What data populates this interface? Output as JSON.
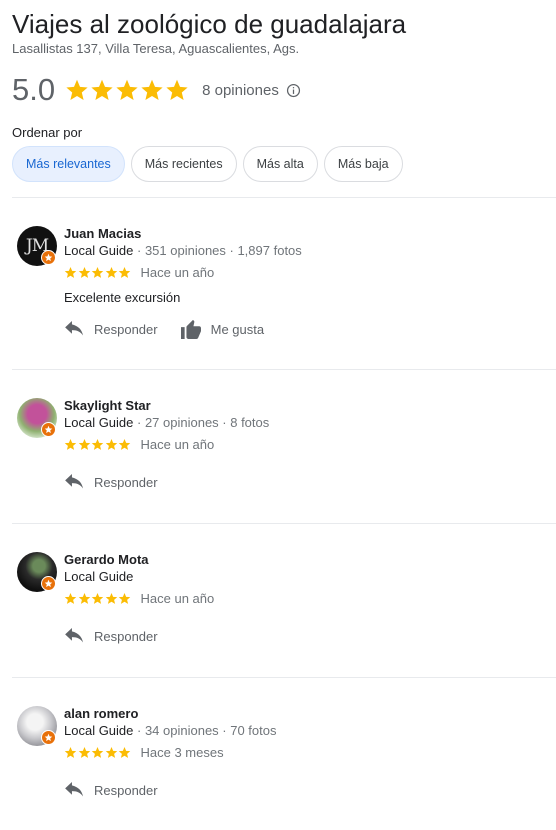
{
  "header": {
    "title": "Viajes al zoológico de guadalajara",
    "address": "Lasallistas 137, Villa Teresa, Aguascalientes, Ags.",
    "rating": "5.0",
    "rating_value": 5,
    "review_count": "8 opiniones"
  },
  "sort": {
    "label": "Ordenar por",
    "options": [
      "Más relevantes",
      "Más recientes",
      "Más alta",
      "Más baja"
    ],
    "selected": "Más relevantes"
  },
  "colors": {
    "star": "#fbbc04",
    "accent": "#1967d2",
    "badge": "#e8710a"
  },
  "reviews": [
    {
      "name": "Juan Macias",
      "guide": "Local Guide",
      "stats": " · 351 opiniones · 1,897 fotos",
      "stars": 5,
      "when": "Hace un año",
      "text": "Excelente excursión",
      "reply_label": "Responder",
      "like_label": "Me gusta",
      "avatar_initials": "JM"
    },
    {
      "name": "Skaylight Star",
      "guide": "Local Guide",
      "stats": " · 27 opiniones · 8 fotos",
      "stars": 5,
      "when": "Hace un año",
      "reply_label": "Responder"
    },
    {
      "name": "Gerardo Mota",
      "guide": "Local Guide",
      "stats": "",
      "stars": 5,
      "when": "Hace un año",
      "reply_label": "Responder"
    },
    {
      "name": "alan romero",
      "guide": "Local Guide",
      "stats": " · 34 opiniones · 70 fotos",
      "stars": 5,
      "when": "Hace 3 meses",
      "reply_label": "Responder"
    }
  ]
}
